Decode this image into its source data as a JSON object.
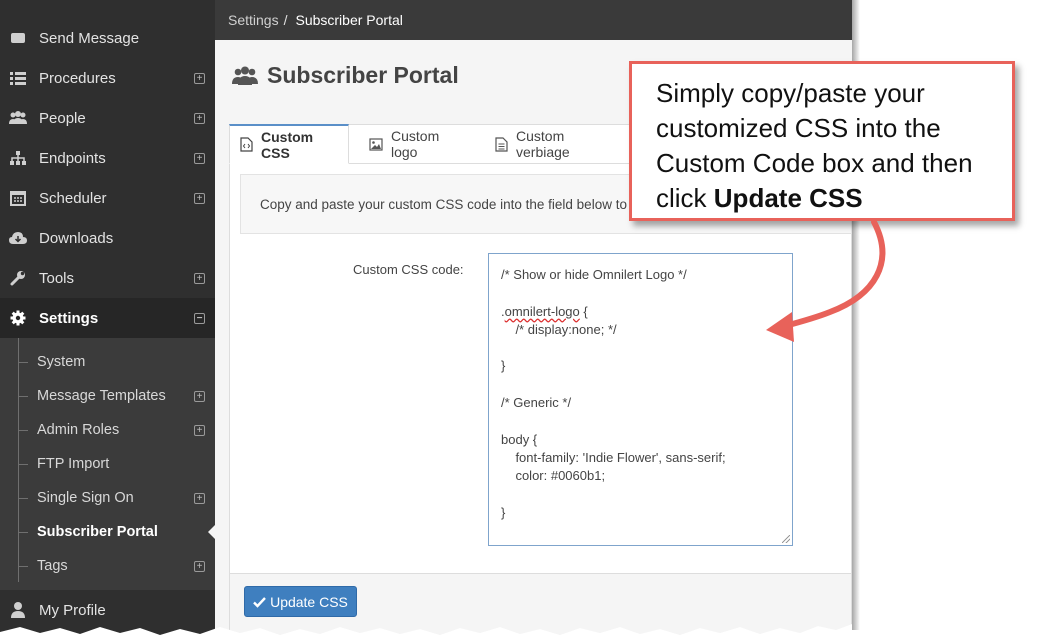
{
  "breadcrumb": {
    "parent": "Settings",
    "separator": "/",
    "current": "Subscriber Portal"
  },
  "sidebar": {
    "items": [
      {
        "label": "Send Message",
        "icon": "message-icon",
        "expandable": false
      },
      {
        "label": "Procedures",
        "icon": "list-icon",
        "expandable": true
      },
      {
        "label": "People",
        "icon": "users-icon",
        "expandable": true
      },
      {
        "label": "Endpoints",
        "icon": "sitemap-icon",
        "expandable": true
      },
      {
        "label": "Scheduler",
        "icon": "calendar-icon",
        "expandable": true
      },
      {
        "label": "Downloads",
        "icon": "cloud-download-icon",
        "expandable": false
      },
      {
        "label": "Tools",
        "icon": "wrench-icon",
        "expandable": true
      },
      {
        "label": "Settings",
        "icon": "gear-icon",
        "expandable": true,
        "expanded": true
      },
      {
        "label": "My Profile",
        "icon": "user-icon",
        "expandable": false
      }
    ],
    "settings_children": [
      {
        "label": "System",
        "expandable": false
      },
      {
        "label": "Message Templates",
        "expandable": true
      },
      {
        "label": "Admin Roles",
        "expandable": true
      },
      {
        "label": "FTP Import",
        "expandable": false
      },
      {
        "label": "Single Sign On",
        "expandable": true
      },
      {
        "label": "Subscriber Portal",
        "expandable": false,
        "current": true
      },
      {
        "label": "Tags",
        "expandable": true
      }
    ]
  },
  "page": {
    "title": "Subscriber Portal",
    "icon": "users-icon"
  },
  "tabs": [
    {
      "label": "Custom CSS",
      "icon": "file-code-icon",
      "active": true
    },
    {
      "label": "Custom logo",
      "icon": "image-icon",
      "active": false
    },
    {
      "label": "Custom verbiage",
      "icon": "file-text-icon",
      "active": false
    }
  ],
  "info_text": "Copy and paste your custom CSS code into the field below to",
  "form": {
    "label": "Custom CSS code:",
    "code_lines": [
      "/* Show or hide Omnilert Logo */",
      "",
      ".omnilert-logo {",
      "    /* display:none; */",
      "",
      "}",
      "",
      "/* Generic */",
      "",
      "body {",
      "    font-family: 'Indie Flower', sans-serif;",
      "    color: #0060b1;",
      "",
      "}"
    ]
  },
  "update_button": {
    "label": "Update CSS",
    "icon": "check-icon"
  },
  "callout": {
    "text_before": "Simply copy/paste your customized CSS into the Custom Code box and then click ",
    "text_bold": "Update CSS"
  },
  "colors": {
    "sidebar": "#2f2f2f",
    "accent": "#3f7fbf",
    "callout_border": "#e8625a"
  }
}
